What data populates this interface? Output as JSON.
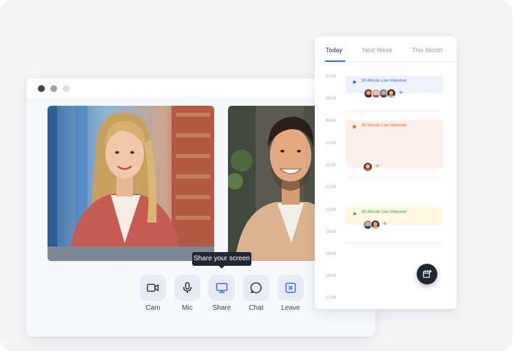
{
  "window": {
    "controls": [
      {
        "id": "cam",
        "label": "Cam",
        "icon": "video-camera-icon"
      },
      {
        "id": "mic",
        "label": "Mic",
        "icon": "microphone-icon"
      },
      {
        "id": "share",
        "label": "Share",
        "icon": "monitor-icon"
      },
      {
        "id": "chat",
        "label": "Chat",
        "icon": "chat-bubble-icon"
      },
      {
        "id": "leave",
        "label": "Leave",
        "icon": "close-square-icon"
      }
    ],
    "tooltip": "Share your screen",
    "accent_color": "#3f63d8",
    "leave_color": "#3f63d8"
  },
  "calendar": {
    "tabs": [
      {
        "label": "Today",
        "active": true
      },
      {
        "label": "Next Week",
        "active": false
      },
      {
        "label": "This Month",
        "active": false
      }
    ],
    "times": [
      "07:00",
      "08:00",
      "09:00",
      "10:00",
      "11:00",
      "12:00",
      "13:00",
      "14:00",
      "15:00",
      "16:00",
      "17:00"
    ],
    "events": [
      {
        "title": "30-Minute Live Interview",
        "color": "#3f63d8",
        "marker": "circle",
        "attendees": 4
      },
      {
        "title": "90-Minute Live Interview",
        "color": "#e56a3a",
        "marker": "square",
        "attendees": 1
      },
      {
        "title": "30-Minute Live Interview",
        "color": "#3f9e46",
        "marker": "triangle",
        "attendees": 2
      }
    ],
    "add_event_icon": "calendar-add-icon"
  }
}
